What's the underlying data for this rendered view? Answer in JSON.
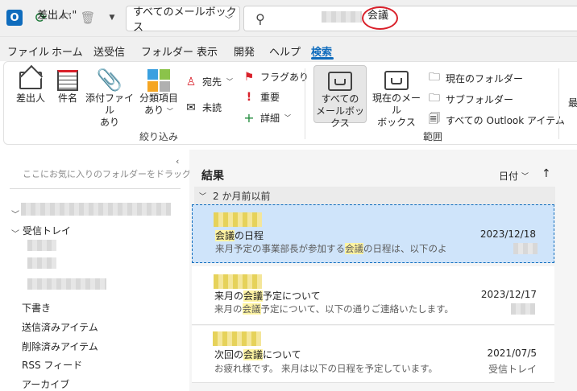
{
  "titlebar": {
    "scope_label": "すべてのメールボックス",
    "search_prefix": "差出人:\"",
    "search_term": "会議"
  },
  "menu": {
    "tabs": [
      "ファイル",
      "ホーム",
      "送受信",
      "フォルダー",
      "表示",
      "開発",
      "ヘルプ",
      "検索"
    ],
    "active": "検索"
  },
  "ribbon": {
    "from": "差出人",
    "subject": "件名",
    "attach": [
      "添付ファイル",
      "あり"
    ],
    "category": [
      "分類項目",
      "あり"
    ],
    "to": "宛先",
    "unread": "未読",
    "flagged": "フラグあり",
    "important": "重要",
    "more": "詳細",
    "refine_group": "絞り込み",
    "all_mailboxes": [
      "すべての",
      "メールボックス"
    ],
    "current_mailbox": [
      "現在のメール",
      "ボックス"
    ],
    "current_folder": "現在のフォルダー",
    "subfolders": "サブフォルダー",
    "all_outlook": "すべての Outlook アイテム",
    "scope_group": "範囲",
    "last": "最"
  },
  "folders": {
    "drag_hint": "ここにお気に入りのフォルダーをドラッグします",
    "inbox": "受信トレイ",
    "items": [
      "下書き",
      "送信済みアイテム",
      "削除済みアイテム",
      "RSS フィード",
      "アーカイブ"
    ]
  },
  "results": {
    "title": "結果",
    "sort_label": "日付",
    "group_label": "2 か月前以前",
    "mails": [
      {
        "subject_hl": "会議",
        "subject_rest": "の日程",
        "preview_pre": "来月予定の事業部長が参加する",
        "preview_hl": "会議",
        "preview_post": "の日程は、以下のよ",
        "date": "2023/12/18",
        "folder": ""
      },
      {
        "subject_pre": "来月の",
        "subject_hl": "会議",
        "subject_rest": "予定について",
        "preview_pre": "来月の",
        "preview_hl": "会議",
        "preview_post": "予定について、以下の通りご連絡いたします。",
        "date": "2023/12/17",
        "folder": ""
      },
      {
        "subject_pre": "次回の",
        "subject_hl": "会議",
        "subject_rest": "について",
        "preview_pre": "お疲れ様です。 来月は以下の日程を予定しています。",
        "date": "2021/07/5",
        "folder": "受信トレイ"
      }
    ]
  },
  "colors": {
    "accent": "#0f6cbd",
    "highlight": "#fff4a3",
    "selection": "#cfe4fa",
    "annotation_red": "#d9202a"
  }
}
